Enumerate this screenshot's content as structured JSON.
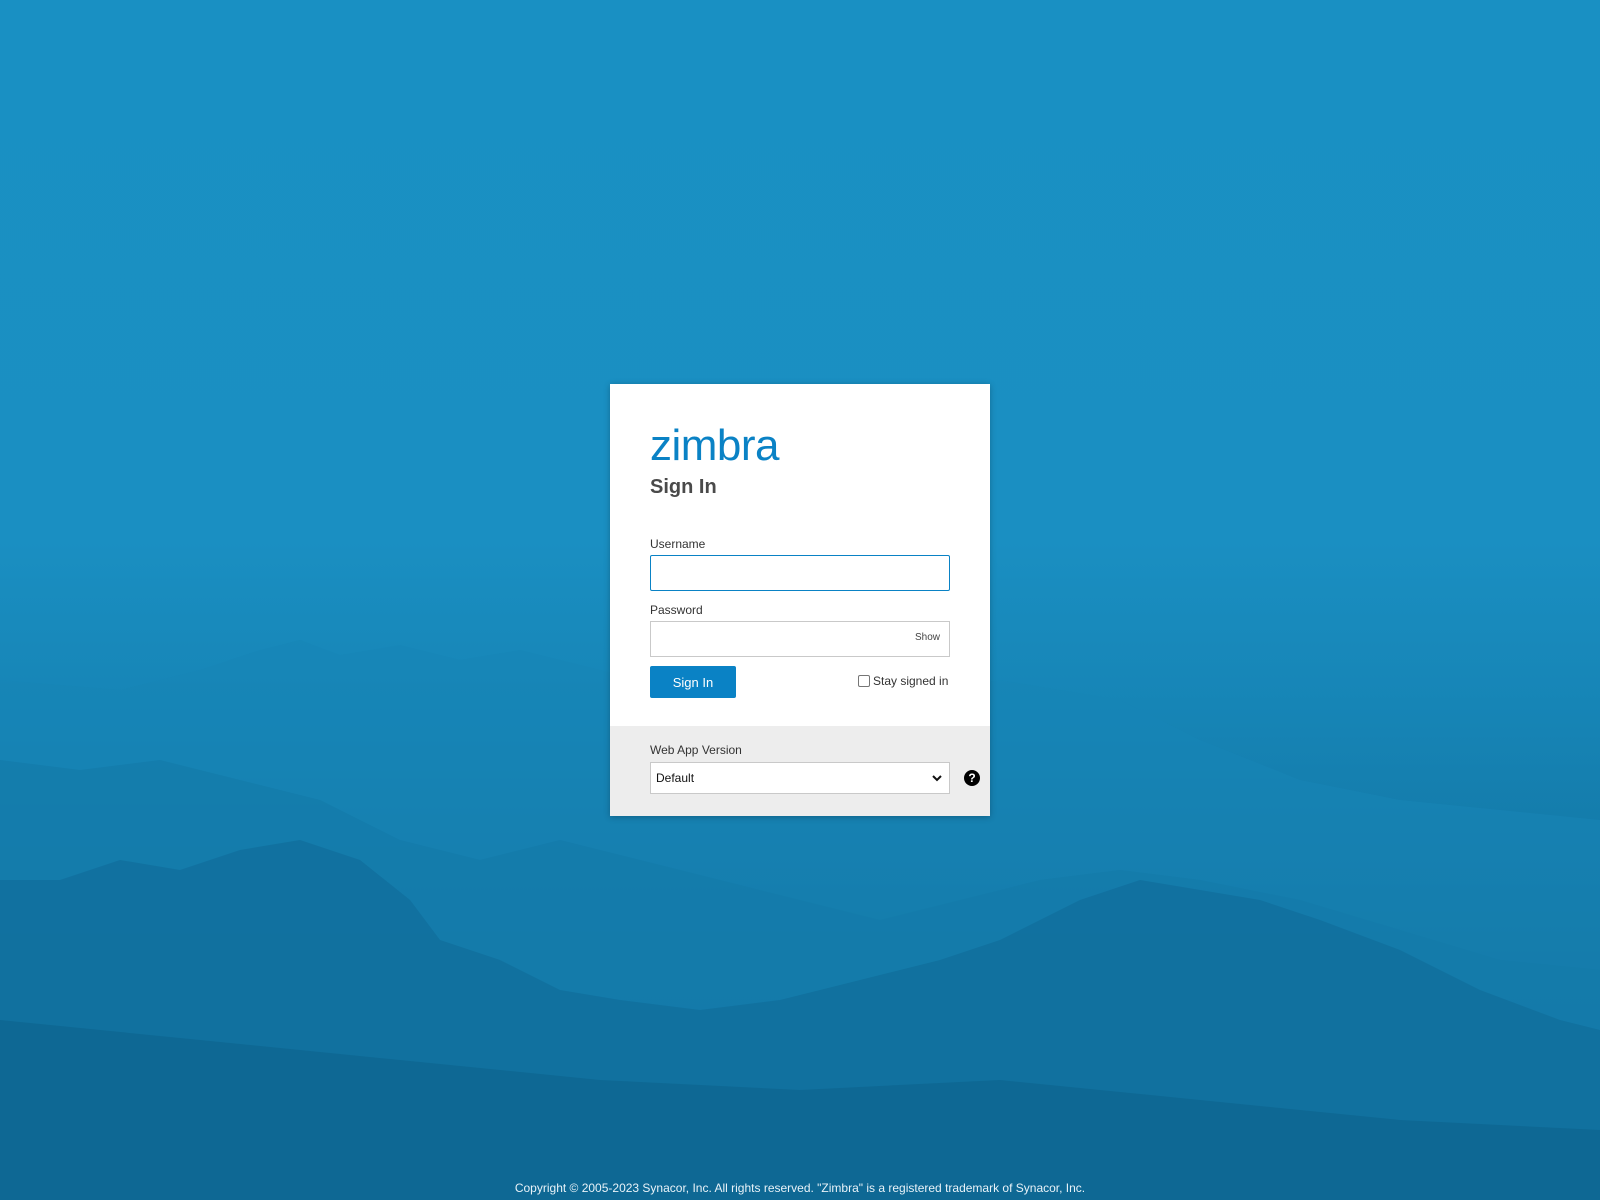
{
  "brand": {
    "logo_text": "zimbra",
    "accent_color": "#0a82c5"
  },
  "form": {
    "title": "Sign In",
    "username_label": "Username",
    "username_value": "",
    "password_label": "Password",
    "password_value": "",
    "show_label": "Show",
    "signin_button": "Sign In",
    "stay_signed_in_label": "Stay signed in",
    "stay_signed_in_checked": false
  },
  "version": {
    "label": "Web App Version",
    "selected": "Default",
    "help_icon": "question-circle-icon"
  },
  "footer": {
    "copyright": "Copyright © 2005-2023 Synacor, Inc. All rights reserved. \"Zimbra\" is a registered trademark of Synacor, Inc."
  }
}
